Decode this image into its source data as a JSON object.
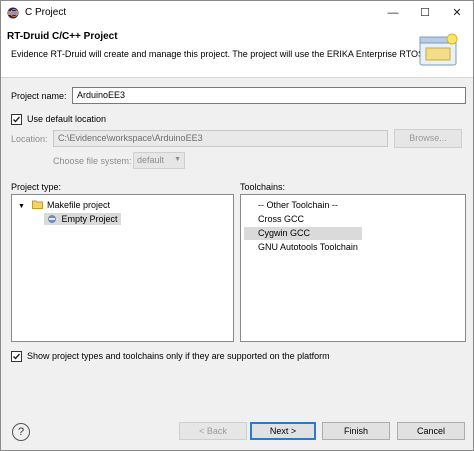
{
  "window": {
    "title": "C Project"
  },
  "header": {
    "title": "RT-Druid C/C++ Project",
    "description": "Evidence RT-Druid will create and manage this project. The project will use the ERIKA Enterprise RTOS."
  },
  "icons": {
    "window": "eclipse-icon",
    "banner": "new-project-wizard-icon",
    "folder": "folder-icon",
    "project": "project-icon",
    "help": "help-icon"
  },
  "form": {
    "project_name_label": "Project name:",
    "project_name_value": "ArduinoEE3",
    "use_default_location_label": "Use default location",
    "use_default_location_checked": true,
    "location_label": "Location:",
    "location_value": "C:\\Evidence\\workspace\\ArduinoEE3",
    "browse_label": "Browse...",
    "file_system_label": "Choose file system:",
    "file_system_value": "default"
  },
  "project_type": {
    "label": "Project type:",
    "tree": [
      {
        "label": "Makefile project",
        "expanded": true,
        "children": [
          {
            "label": "Empty Project",
            "selected": true
          }
        ]
      }
    ]
  },
  "toolchains": {
    "label": "Toolchains:",
    "items": [
      "-- Other Toolchain --",
      "Cross GCC",
      "Cygwin GCC",
      "GNU Autotools Toolchain"
    ],
    "selected_index": 2
  },
  "filter": {
    "label": "Show project types and toolchains only if they are supported on the platform",
    "checked": true
  },
  "buttons": {
    "back": "< Back",
    "next": "Next >",
    "finish": "Finish",
    "cancel": "Cancel"
  },
  "colors": {
    "default_button_border": "#2a7ad2",
    "selection": "#dadada"
  }
}
